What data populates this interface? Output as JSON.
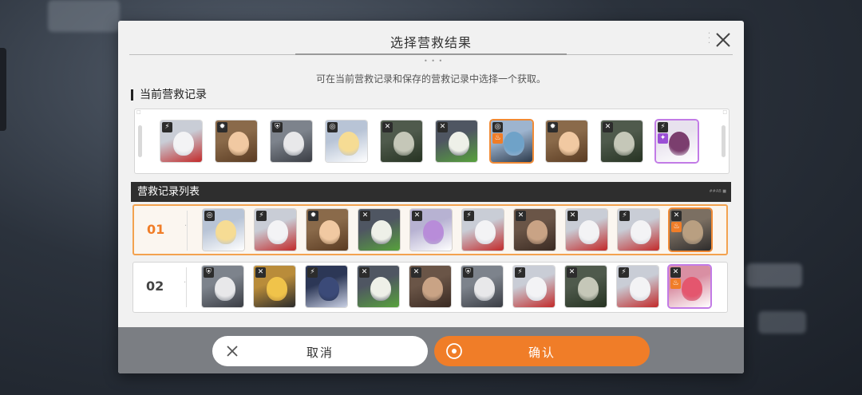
{
  "dialog": {
    "title": "选择营救结果",
    "subtitle": "可在当前营救记录和保存的营救记录中选择一个获取。",
    "current_section_label": "当前营救记录",
    "list_header": "营救记录列表",
    "list_header_tag": "##AB ■"
  },
  "icons": {
    "close": "close-x-icon",
    "cancel": "x-cross-icon",
    "confirm": "target-circle-icon",
    "card_badges": [
      "lightning-icon",
      "gear-icon",
      "shield-icon",
      "sword-icon",
      "flame-icon",
      "sparkle-icon"
    ]
  },
  "current_records": [
    {
      "portrait": "white-fox-mask",
      "badge": "lightning-icon"
    },
    {
      "portrait": "brown-hat-girl",
      "badge": "gear-icon"
    },
    {
      "portrait": "white-hair-boy",
      "badge": "shield-icon"
    },
    {
      "portrait": "blonde-girl",
      "badge": "target-icon"
    },
    {
      "portrait": "green-officer-beast",
      "badge": "sword-icon"
    },
    {
      "portrait": "green-mask-hood",
      "badge": "sword-icon"
    },
    {
      "portrait": "blue-hair-headphones",
      "badge": "target-icon",
      "badge2": "flame-icon",
      "highlight": "orange"
    },
    {
      "portrait": "brown-hat-girl",
      "badge": "gear-icon"
    },
    {
      "portrait": "green-officer-beast",
      "badge": "sword-icon"
    },
    {
      "portrait": "purple-hair-man",
      "badge": "lightning-icon",
      "badge2": "sparkle-icon",
      "highlight": "purple"
    }
  ],
  "saved_records": [
    {
      "number": "01",
      "selected": true,
      "cards": [
        {
          "portrait": "blonde-girl",
          "badge": "target-icon"
        },
        {
          "portrait": "white-fox-mask",
          "badge": "lightning-icon"
        },
        {
          "portrait": "brown-hat-girl",
          "badge": "gear-icon"
        },
        {
          "portrait": "green-mask-hood",
          "badge": "sword-icon"
        },
        {
          "portrait": "purple-hair-girl",
          "badge": "sword-icon"
        },
        {
          "portrait": "white-fox-mask",
          "badge": "lightning-icon"
        },
        {
          "portrait": "brown-hair-girl",
          "badge": "sword-icon"
        },
        {
          "portrait": "white-fox-mask",
          "badge": "sword-icon"
        },
        {
          "portrait": "white-fox-mask",
          "badge": "lightning-icon"
        },
        {
          "portrait": "brown-hair-smile",
          "badge": "sword-icon",
          "badge2": "flame-icon",
          "highlight": "orange"
        }
      ]
    },
    {
      "number": "02",
      "selected": false,
      "cards": [
        {
          "portrait": "white-hair-boy",
          "badge": "shield-icon"
        },
        {
          "portrait": "yellow-hair-girl",
          "badge": "sword-icon"
        },
        {
          "portrait": "dark-blue-hair",
          "badge": "lightning-icon"
        },
        {
          "portrait": "green-mask-hood",
          "badge": "sword-icon"
        },
        {
          "portrait": "brown-hair-girl",
          "badge": "sword-icon"
        },
        {
          "portrait": "white-hair-boy",
          "badge": "shield-icon"
        },
        {
          "portrait": "white-fox-mask",
          "badge": "lightning-icon"
        },
        {
          "portrait": "green-officer-beast",
          "badge": "sword-icon"
        },
        {
          "portrait": "white-fox-mask",
          "badge": "lightning-icon"
        },
        {
          "portrait": "red-hair-girl",
          "badge": "sword-icon",
          "badge2": "flame-icon",
          "highlight": "pink"
        }
      ]
    }
  ],
  "buttons": {
    "cancel_label": "取消",
    "confirm_label": "确认"
  },
  "colors": {
    "accent": "#f07d28",
    "selected_border": "#f3a24f",
    "purple_rarity": "#c27be6",
    "header_bg": "#2e2e2e"
  }
}
